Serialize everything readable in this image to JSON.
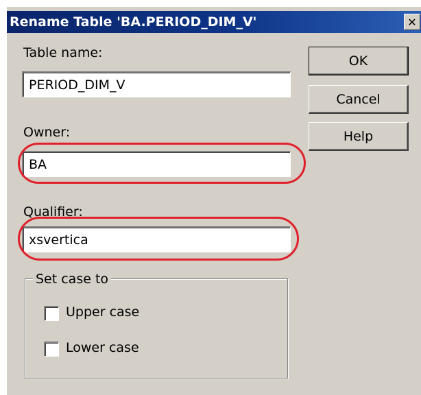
{
  "dialog": {
    "title": "Rename Table 'BA.PERIOD_DIM_V'",
    "close_glyph": "✕"
  },
  "fields": {
    "table_name": {
      "label": "Table name:",
      "value": "PERIOD_DIM_V"
    },
    "owner": {
      "label": "Owner:",
      "value": "BA"
    },
    "qualifier": {
      "label": "Qualifier:",
      "value": "xsvertica"
    }
  },
  "buttons": {
    "ok": "OK",
    "cancel": "Cancel",
    "help": "Help"
  },
  "case_group": {
    "legend": "Set case to",
    "upper": {
      "label": "Upper case",
      "checked": false
    },
    "lower": {
      "label": "Lower case",
      "checked": false
    }
  },
  "annotation": {
    "highlight_color": "#e0202a"
  },
  "colors": {
    "dialog_bg": "#d4d0c8",
    "titlebar": "#0a246a"
  }
}
